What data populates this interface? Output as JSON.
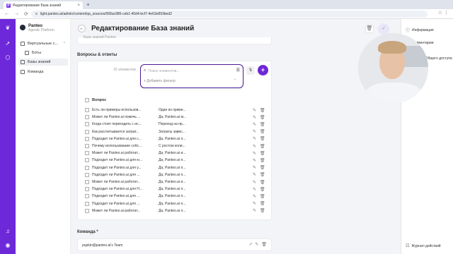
{
  "browser": {
    "tab_title": "Редактирование База знаний",
    "tab_close": "×",
    "new_tab": "+",
    "url": "light.panteo.ai/admin/content/qa_sources/068ac985-ceb1-40d4-bcf7-4e63e893bed2",
    "url_icon": "≡",
    "back_glyph": "←",
    "forward_glyph": "→",
    "reload_glyph": "⟳",
    "addr_right": "☆ ⋮",
    "favicon": "P"
  },
  "rail": {
    "icons": [
      "logo-icon",
      "rocket-icon",
      "cube-icon",
      "bell-icon",
      "user-icon"
    ],
    "glyphs": [
      "❦",
      "➚",
      "⬡",
      "♫",
      "◉"
    ]
  },
  "nav": {
    "brand_name": "Panteo",
    "brand_sub": "Agentic Platform",
    "items": [
      {
        "label": "Виртуальные с...",
        "icon": "agent-icon"
      },
      {
        "label": "Боты",
        "icon": "bot-icon"
      },
      {
        "label": "Базы знаний",
        "icon": "database-icon"
      },
      {
        "label": "Команда",
        "icon": "team-icon"
      }
    ],
    "chevron": "⌃"
  },
  "main": {
    "page_title": "Редактирование База знаний",
    "back_glyph": "←",
    "trash_glyph": "🗑",
    "check_glyph": "✓",
    "cut_text": "База знаний Panteo",
    "qa_section_label": "Вопросы & ответы",
    "count": "15 элементов",
    "filter_glyph": "⇅",
    "add_glyph": "+",
    "search": {
      "placeholder": "Поиск элементов...",
      "value": "",
      "search_glyph": "⌕",
      "sort_glyph": "☰"
    },
    "add_filter": "+ Добавить фильтр",
    "filter_chevron": "⌄",
    "column_question": "Вопрос",
    "edit_glyph": "✎",
    "delete_glyph": "🗑",
    "rows": [
      {
        "q": "Есть ли примеры использов...",
        "a": "Один из приме..."
      },
      {
        "q": "Может ли Panteo.ai помочь ...",
        "a": "Да, Panteo.ai м..."
      },
      {
        "q": "Когда стоит переходить с ис...",
        "a": "Переход на пр..."
      },
      {
        "q": "Как рассчитывается затрат...",
        "a": "Затраты завис..."
      },
      {
        "q": "Подходит ли Panteo.ai для с...",
        "a": "Да, Panteo.ai п..."
      },
      {
        "q": "Почему использование собс...",
        "a": "С ростом коли..."
      },
      {
        "q": "Может ли Panteo.ai работат...",
        "a": "Да, Panteo.ai и..."
      },
      {
        "q": "Подходит ли Panteo.ai для ю...",
        "a": "Да, Panteo.ai п..."
      },
      {
        "q": "Подходит ли Panteo.ai для у...",
        "a": "Да, Panteo.ai п..."
      },
      {
        "q": "Подходит ли Panteo.ai для ...",
        "a": "Да, Panteo.ai п..."
      },
      {
        "q": "Может ли Panteo.ai работат...",
        "a": "Да, Panteo.ai и..."
      },
      {
        "q": "Подходит ли Panteo.ai для Н...",
        "a": "Да, Panteo.ai п..."
      },
      {
        "q": "Подходит ли Panteo.ai для ...",
        "a": "Да, Panteo.ai п..."
      },
      {
        "q": "Подходит ли Panteo.ai для ...",
        "a": "Да, Panteo.ai п..."
      },
      {
        "q": "Может ли Panteo.ai работат...",
        "a": "Да, Panteo.ai п..."
      }
    ],
    "team_label": "Команда *",
    "team_value": "pupkin@panteo.ai's Team",
    "team_icons": [
      "↗",
      "✎",
      "🗑"
    ]
  },
  "right_panel": {
    "items": [
      {
        "label": "Информация",
        "glyph": "ⓘ"
      },
      {
        "label": "Комментарии",
        "glyph": "✉"
      },
      {
        "label": "Ответы Общего доступа",
        "glyph": "⤴"
      }
    ],
    "activity_log": "Журнал действий",
    "activity_glyph": "☷"
  },
  "colors": {
    "brand": "#6d28d9",
    "popup_border": "#4c1d95"
  }
}
